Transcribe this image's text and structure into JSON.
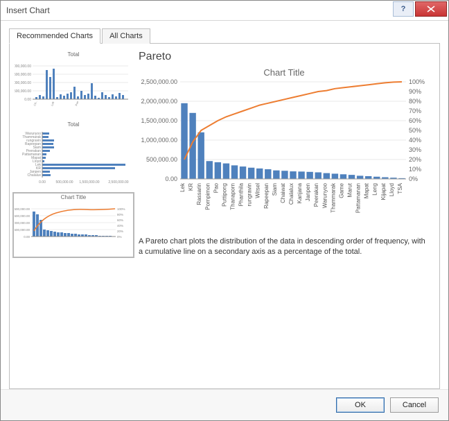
{
  "window": {
    "title": "Insert Chart"
  },
  "tabs": {
    "recommended": "Recommended Charts",
    "all": "All Charts",
    "active": "recommended"
  },
  "preview": {
    "heading": "Pareto",
    "chart_title": "Chart Title",
    "description": "A Pareto chart plots the distribution of the data in descending order of frequency, with a cumulative line on a secondary axis as a percentage of the total."
  },
  "thumbs": [
    {
      "title": "Total",
      "type": "column"
    },
    {
      "title": "Total",
      "type": "bar"
    },
    {
      "title": "Chart Title",
      "type": "pareto",
      "selected": true
    }
  ],
  "buttons": {
    "ok": "OK",
    "cancel": "Cancel"
  },
  "chart_data": {
    "type": "pareto",
    "title": "Chart Title",
    "xlabel": "",
    "ylabel": "",
    "ylim": [
      0,
      2500000
    ],
    "y_ticks": [
      "0.00",
      "500,000.00",
      "1,000,000.00",
      "1,500,000.00",
      "2,000,000.00",
      "2,500,000.00"
    ],
    "y2_ticks": [
      "0%",
      "10%",
      "20%",
      "30%",
      "40%",
      "50%",
      "60%",
      "70%",
      "80%",
      "90%",
      "100%"
    ],
    "categories": [
      "Lek",
      "KR",
      "Rassarin",
      "Pornpimon",
      "Pao",
      "Puttipong",
      "Thanaporn",
      "Phanthila",
      "rungravin",
      "Witsel",
      "Rapeepan",
      "Siam",
      "Chaiwat",
      "Chalalux",
      "Kanjana",
      "Janpen",
      "Peerakan",
      "Warunyoo",
      "Thammarak",
      "Game",
      "Marut",
      "Pattamanan",
      "Mapat",
      "Leng",
      "Kijapat",
      "Lloyd",
      "TSA"
    ],
    "values": [
      1950000,
      1700000,
      1200000,
      460000,
      430000,
      400000,
      350000,
      320000,
      290000,
      270000,
      250000,
      220000,
      210000,
      195000,
      190000,
      182000,
      170000,
      150000,
      135000,
      120000,
      105000,
      82000,
      72000,
      58000,
      44000,
      32000,
      20000
    ],
    "cumulative_pct": [
      20,
      38,
      50,
      55,
      60,
      64,
      67,
      70,
      73,
      76,
      78,
      80,
      82,
      84,
      86,
      88,
      90,
      91,
      93,
      94,
      95,
      96,
      97,
      98,
      99,
      99.7,
      100
    ]
  }
}
